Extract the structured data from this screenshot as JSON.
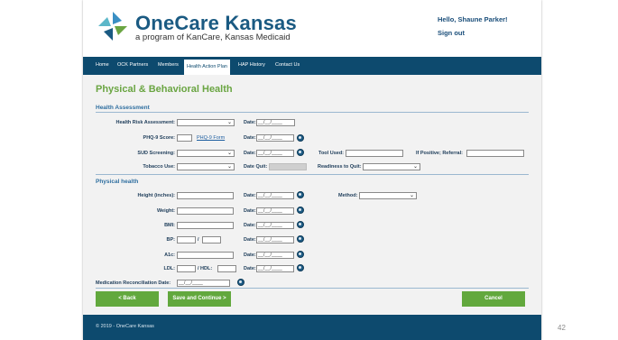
{
  "brand": {
    "name": "OneCare Kansas",
    "tagline": "a program of KanCare, Kansas Medicaid",
    "colors": {
      "navy": "#0d4a6e",
      "green": "#6aa542",
      "button_green": "#62a83d"
    }
  },
  "user": {
    "greeting": "Hello, Shaune Parker!",
    "signout": "Sign out"
  },
  "nav": {
    "items": [
      {
        "label": "Home"
      },
      {
        "label": "OCK Partners"
      },
      {
        "label": "Members"
      },
      {
        "label": "Health Action Plan",
        "active": true
      },
      {
        "label": "HAP History"
      },
      {
        "label": "Contact Us"
      }
    ]
  },
  "page": {
    "title": "Physical & Behavioral Health"
  },
  "health_assessment": {
    "title": "Health Assessment",
    "hra_label": "Health Risk Assessment:",
    "phq9_label": "PHQ-9 Score:",
    "phq9_link": "PHQ-9 Form",
    "sud_label": "SUD Screening:",
    "tool_used_label": "Tool Used:",
    "if_positive_label": "If Positive; Referral:",
    "tobacco_label": "Tobacco Use:",
    "date_quit_label": "Date Quit:",
    "readiness_label": "Readiness to Quit:",
    "date_label": "Date:",
    "date_mask": "__/__/____"
  },
  "physical_health": {
    "title": "Physical health",
    "height_label": "Height (inches):",
    "weight_label": "Weight:",
    "bmi_label": "BMI:",
    "bp_label": "BP:",
    "bp_sep": "/",
    "a1c_label": "A1c:",
    "ldl_label": "LDL:",
    "hdl_label": "/ HDL:",
    "method_label": "Method:",
    "med_rec_label": "Medication Reconciliation Date:",
    "date_label": "Date:",
    "date_mask": "__/__/____"
  },
  "actions": {
    "back": "< Back",
    "save_continue": "Save and Continue >",
    "cancel": "Cancel"
  },
  "footer": {
    "copyright": "© 2019 - OneCare Kansas"
  },
  "slide_number": "42"
}
